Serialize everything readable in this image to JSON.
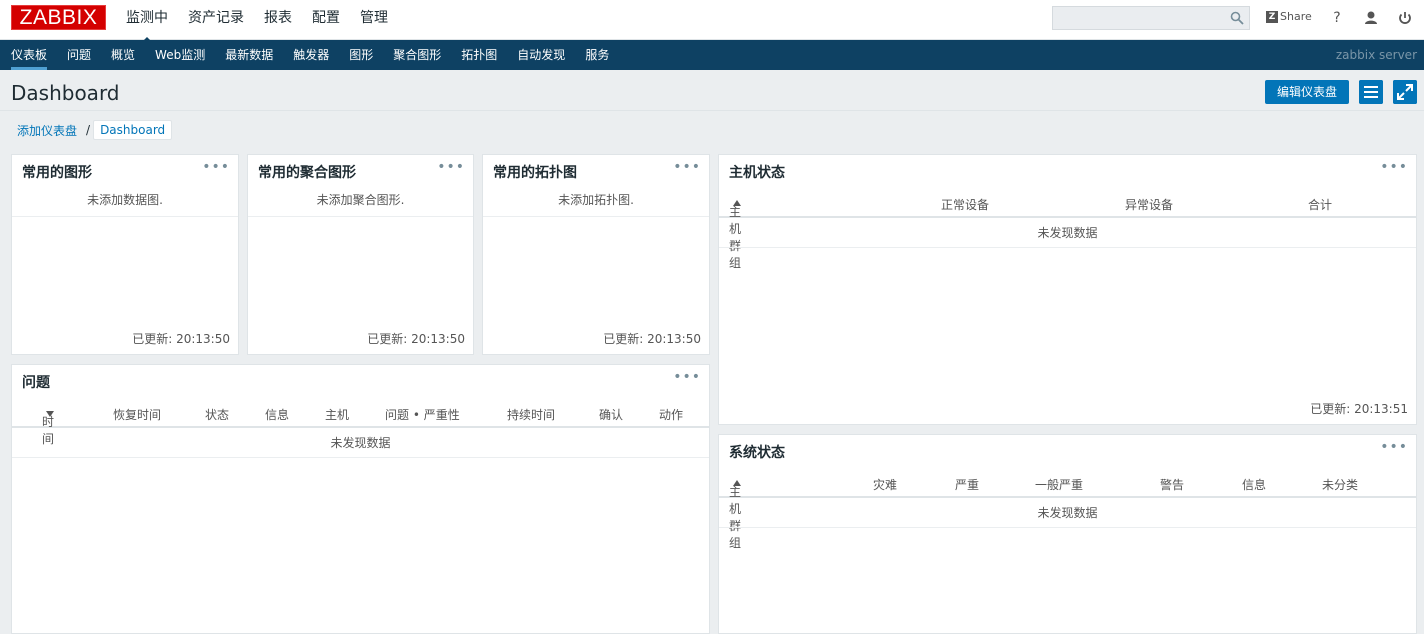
{
  "brand": {
    "logo_text": "ZABBIX",
    "color": "#d40000"
  },
  "topnav": {
    "items": [
      "监测中",
      "资产记录",
      "报表",
      "配置",
      "管理"
    ],
    "active": "监测中"
  },
  "search": {
    "value": ""
  },
  "top_icons": {
    "share_label": "Share",
    "help": "?"
  },
  "subnav": {
    "items": [
      "仪表板",
      "问题",
      "概览",
      "Web监测",
      "最新数据",
      "触发器",
      "图形",
      "聚合图形",
      "拓扑图",
      "自动发现",
      "服务"
    ],
    "active": "仪表板",
    "server": "zabbix server"
  },
  "page": {
    "title": "Dashboard",
    "edit_button": "编辑仪表盘"
  },
  "breadcrumb": {
    "parent": "添加仪表盘",
    "separator": "/",
    "current": "Dashboard"
  },
  "widgets": {
    "fav_graphs": {
      "title": "常用的图形",
      "empty": "未添加数据图.",
      "updated": "已更新: 20:13:50"
    },
    "fav_screens": {
      "title": "常用的聚合图形",
      "empty": "未添加聚合图形.",
      "updated": "已更新: 20:13:50"
    },
    "fav_maps": {
      "title": "常用的拓扑图",
      "empty": "未添加拓扑图.",
      "updated": "已更新: 20:13:50"
    },
    "host_status": {
      "title": "主机状态",
      "columns": [
        "主机群组",
        "正常设备",
        "异常设备",
        "合计"
      ],
      "nodata": "未发现数据",
      "updated": "已更新: 20:13:51"
    },
    "problems": {
      "title": "问题",
      "columns": [
        "时间",
        "恢复时间",
        "状态",
        "信息",
        "主机",
        "问题 • 严重性",
        "持续时间",
        "确认",
        "动作"
      ],
      "nodata": "未发现数据"
    },
    "system_status": {
      "title": "系统状态",
      "columns": [
        "主机群组",
        "灾难",
        "严重",
        "一般严重",
        "警告",
        "信息",
        "未分类"
      ],
      "nodata": "未发现数据"
    }
  }
}
